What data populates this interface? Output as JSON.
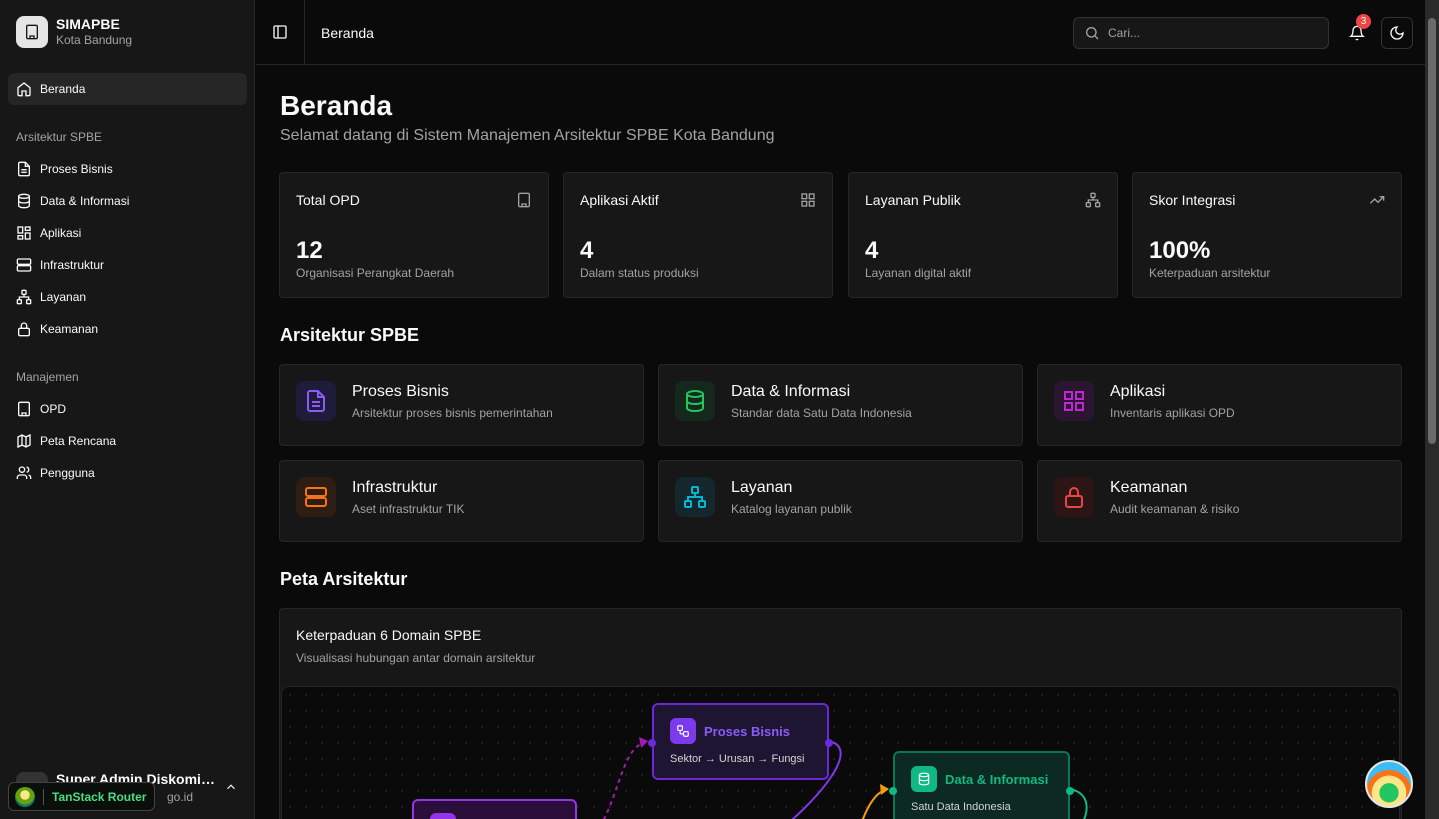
{
  "app": {
    "brand_title": "SIMAPBE",
    "brand_subtitle": "Kota Bandung"
  },
  "sidebar": {
    "home_label": "Beranda",
    "group1_label": "Arsitektur SPBE",
    "group1_items": [
      {
        "label": "Proses Bisnis",
        "icon": "file-text-icon"
      },
      {
        "label": "Data & Informasi",
        "icon": "database-icon"
      },
      {
        "label": "Aplikasi",
        "icon": "grid-icon"
      },
      {
        "label": "Infrastruktur",
        "icon": "server-icon"
      },
      {
        "label": "Layanan",
        "icon": "network-icon"
      },
      {
        "label": "Keamanan",
        "icon": "lock-icon"
      }
    ],
    "group2_label": "Manajemen",
    "group2_items": [
      {
        "label": "OPD",
        "icon": "building-icon"
      },
      {
        "label": "Peta Rencana",
        "icon": "map-icon"
      },
      {
        "label": "Pengguna",
        "icon": "users-icon"
      }
    ],
    "user_name": "Super Admin Diskominfo",
    "user_email": "go.id",
    "devtools_label": "TanStack Router"
  },
  "header": {
    "title": "Beranda",
    "search_placeholder": "Cari...",
    "notification_count": "3"
  },
  "main": {
    "title": "Beranda",
    "subtitle": "Selamat datang di Sistem Manajemen Arsitektur SPBE Kota Bandung",
    "stats": [
      {
        "label": "Total OPD",
        "value": "12",
        "desc": "Organisasi Perangkat Daerah",
        "icon": "building-icon"
      },
      {
        "label": "Aplikasi Aktif",
        "value": "4",
        "desc": "Dalam status produksi",
        "icon": "grid-icon"
      },
      {
        "label": "Layanan Publik",
        "value": "4",
        "desc": "Layanan digital aktif",
        "icon": "network-icon"
      },
      {
        "label": "Skor Integrasi",
        "value": "100%",
        "desc": "Keterpaduan arsitektur",
        "icon": "trending-up-icon"
      }
    ],
    "section_arch": "Arsitektur SPBE",
    "domains": [
      {
        "title": "Proses Bisnis",
        "desc": "Arsitektur proses bisnis pemerintahan",
        "color": "#8b5cf6"
      },
      {
        "title": "Data & Informasi",
        "desc": "Standar data Satu Data Indonesia",
        "color": "#22c55e"
      },
      {
        "title": "Aplikasi",
        "desc": "Inventaris aplikasi OPD",
        "color": "#c026d3"
      },
      {
        "title": "Infrastruktur",
        "desc": "Aset infrastruktur TIK",
        "color": "#f97316"
      },
      {
        "title": "Layanan",
        "desc": "Katalog layanan publik",
        "color": "#06b6d4"
      },
      {
        "title": "Keamanan",
        "desc": "Audit keamanan & risiko",
        "color": "#ef4444"
      }
    ],
    "section_map": "Peta Arsitektur",
    "map_title": "Keterpaduan 6 Domain SPBE",
    "map_desc": "Visualisasi hubungan antar domain arsitektur",
    "nodes": [
      {
        "title": "Proses Bisnis",
        "sub": "Sektor → Urusan → Fungsi",
        "color": "#8b5cf6"
      },
      {
        "title": "Data & Informasi",
        "sub": "Satu Data Indonesia",
        "color": "#10b981"
      }
    ]
  }
}
